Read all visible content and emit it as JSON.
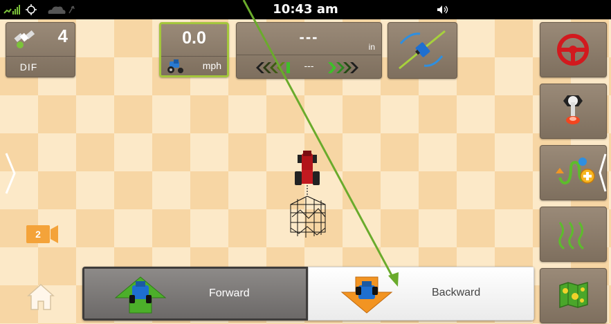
{
  "status_bar": {
    "time": "10:43 am",
    "icons": [
      "gps-signal-icon",
      "network-icon",
      "cloud-sync-icon",
      "volume-icon"
    ]
  },
  "gps_tile": {
    "satellite_count": "4",
    "correction_label": "DIF",
    "icon": "satellite-icon"
  },
  "speed_tile": {
    "value": "0.0",
    "unit": "mph",
    "icon": "tractor-icon",
    "highlight_color": "#a4c63c"
  },
  "guidance_tile": {
    "offset_value": "---",
    "unit": "in",
    "mid_value": "---",
    "left_color": "#5b8a13",
    "right_color": "#2aa52a"
  },
  "autoline_tile": {
    "icon": "guidance-line-icon"
  },
  "right_panel": {
    "buttons": [
      {
        "name": "autosteer-button",
        "icon": "steering-wheel-icon"
      },
      {
        "name": "engage-switch-button",
        "icon": "toggle-switch-icon"
      },
      {
        "name": "add-guidance-line-button",
        "icon": "add-curve-icon"
      },
      {
        "name": "guidance-pattern-button",
        "icon": "curve-pattern-icon"
      },
      {
        "name": "field-map-button",
        "icon": "field-map-icon"
      }
    ]
  },
  "camera_badge": {
    "number": "2",
    "icon": "camera-icon"
  },
  "direction": {
    "forward_label": "Forward",
    "backward_label": "Backward",
    "forward_color": "#4caf2a",
    "backward_color": "#f29422"
  },
  "colors": {
    "field_light": "#fce9c8",
    "field_dark": "#f7d6a4",
    "tile_bg": "#8c7c6a",
    "pointer": "#6aab2c"
  }
}
